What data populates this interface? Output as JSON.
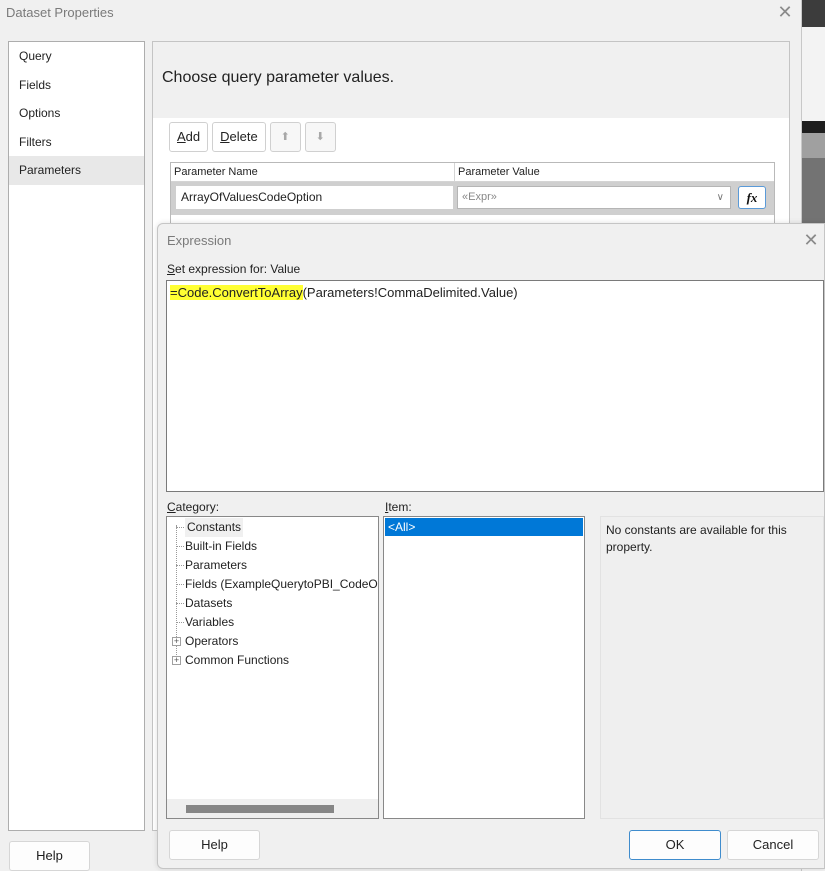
{
  "outer_dialog": {
    "title": "Dataset Properties",
    "close_glyph": "✕",
    "nav": [
      {
        "label": "Query",
        "active": false
      },
      {
        "label": "Fields",
        "active": false
      },
      {
        "label": "Options",
        "active": false
      },
      {
        "label": "Filters",
        "active": false
      },
      {
        "label": "Parameters",
        "active": true
      }
    ],
    "header": "Choose query parameter values.",
    "toolbar": {
      "add_label_u": "A",
      "add_label_rest": "dd",
      "delete_label_u": "D",
      "delete_label_rest": "elete",
      "move_up_glyph": "⬆",
      "move_down_glyph": "⬇"
    },
    "grid": {
      "columns": [
        "Parameter Name",
        "Parameter Value"
      ],
      "rows": [
        {
          "name": "ArrayOfValuesCodeOption",
          "value": "«Expr»"
        }
      ],
      "fx_label": "fx",
      "chevron_glyph": "∨"
    },
    "help_label": "Help"
  },
  "expression_dialog": {
    "title": "Expression",
    "close_glyph": "✕",
    "set_label_u": "S",
    "set_label_rest": "et expression for: Value",
    "expression_highlight": "=Code.ConvertToArray",
    "expression_rest": "(Parameters!CommaDelimited.Value)",
    "category_label_u": "C",
    "category_label_rest": "ategory:",
    "item_label_u": "I",
    "item_label_rest": "tem:",
    "categories": [
      {
        "label": "Constants",
        "expandable": false,
        "selected": true
      },
      {
        "label": "Built-in Fields",
        "expandable": false,
        "selected": false
      },
      {
        "label": "Parameters",
        "expandable": false,
        "selected": false
      },
      {
        "label": "Fields (ExampleQuerytoPBI_CodeO",
        "expandable": false,
        "selected": false
      },
      {
        "label": "Datasets",
        "expandable": false,
        "selected": false
      },
      {
        "label": "Variables",
        "expandable": false,
        "selected": false
      },
      {
        "label": "Operators",
        "expandable": true,
        "selected": false
      },
      {
        "label": "Common Functions",
        "expandable": true,
        "selected": false
      }
    ],
    "items": [
      {
        "label": "<All>",
        "selected": true
      }
    ],
    "description": "No constants are available for this property.",
    "buttons": {
      "help": "Help",
      "ok": "OK",
      "cancel": "Cancel"
    }
  }
}
